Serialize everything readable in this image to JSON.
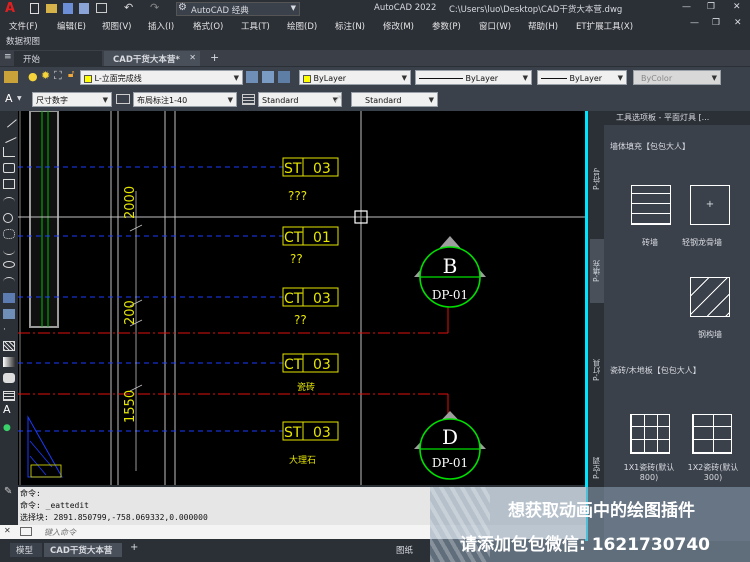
{
  "titlebar": {
    "logo": "A",
    "workspace": "AutoCAD 经典",
    "app": "AutoCAD 2022",
    "path": "C:\\Users\\luo\\Desktop\\CAD干货大本营.dwg",
    "minimize": "—",
    "restore": "❐",
    "close": "✕"
  },
  "menu": [
    "文件(F)",
    "编辑(E)",
    "视图(V)",
    "插入(I)",
    "格式(O)",
    "工具(T)",
    "绘图(D)",
    "标注(N)",
    "修改(M)",
    "参数(P)",
    "窗口(W)",
    "帮助(H)",
    "ET扩展工具(X)"
  ],
  "subbar": {
    "label": "数据视图"
  },
  "tabs": {
    "start": "开始",
    "doc": "CAD干货大本营*",
    "add": "+",
    "menu": "≡"
  },
  "toolbar1": {
    "layer": "L-立面完成线",
    "color": "ByLayer",
    "linetype": "ByLayer",
    "lineweight": "ByLayer",
    "plotstyle": "ByColor"
  },
  "toolbar2": {
    "textstyle": "尺寸数字",
    "dimstyle": "布局标注1-40",
    "tablestyle": "Standard",
    "mleaderstyle": "Standard"
  },
  "drawing": {
    "dims": [
      "2000",
      "200",
      "1550"
    ],
    "tags": [
      {
        "code": "ST",
        "num": "03",
        "note": "???"
      },
      {
        "code": "CT",
        "num": "01",
        "note": "??"
      },
      {
        "code": "CT",
        "num": "03",
        "note": "??"
      },
      {
        "code": "CT",
        "num": "03",
        "note": "瓷砖"
      },
      {
        "code": "ST",
        "num": "03",
        "note": "大理石"
      }
    ],
    "symbols": [
      {
        "letter": "B",
        "code": "DP-01"
      },
      {
        "letter": "D",
        "code": "DP-01"
      }
    ]
  },
  "palette": {
    "title": "工具选项板 - 平面灯具 [...",
    "tabs": [
      "P-符号",
      "P-填充",
      "P-灯具",
      "P-空调"
    ],
    "section1": "墙体填充【包包大人】",
    "items1": [
      "砖墙",
      "轻钢龙骨墙",
      "钢构墙"
    ],
    "section2": "瓷砖/木地板【包包大人】",
    "items2": [
      "1X1瓷砖(默认800)",
      "1X2瓷砖(默认300)"
    ]
  },
  "command": {
    "line1": "命令:",
    "line2": "命令: _eattedit",
    "line3": "选择块: 2891.850799,-758.069332,0.000000",
    "prompt": "键入命令",
    "close": "✕"
  },
  "status": {
    "model": "模型",
    "layout": "CAD干货大本营",
    "add": "+",
    "grid": "图纸"
  },
  "watermark": {
    "line1": "想获取动画中的绘图插件",
    "line2": "请添加包包微信: 1621730740"
  },
  "colors": {
    "accent": "#00e5ff",
    "tag": "#e5e500",
    "circle": "#00e000",
    "dashBlue": "#1a3cff",
    "dashRed": "#e01010"
  }
}
